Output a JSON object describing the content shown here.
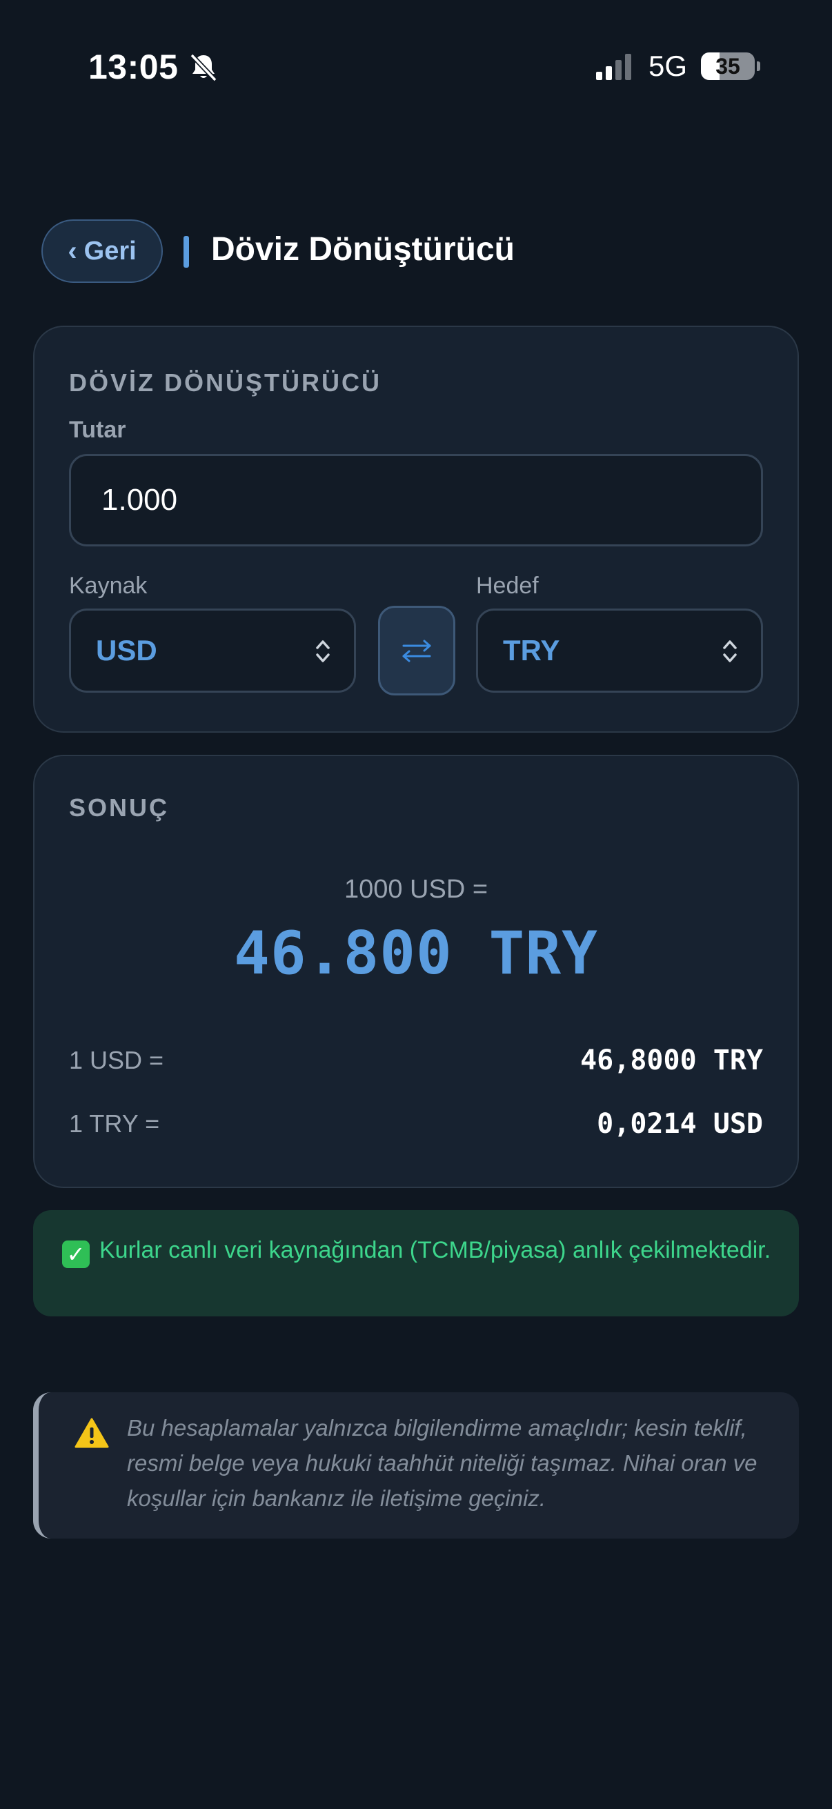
{
  "status_bar": {
    "time": "13:05",
    "network": "5G",
    "battery": "35",
    "battery_level": 0.35
  },
  "header": {
    "back_label": "Geri",
    "title": "Döviz Dönüştürücü"
  },
  "converter": {
    "section_title": "DÖVİZ DÖNÜŞTÜRÜCÜ",
    "amount_label": "Tutar",
    "amount_value": "1.000",
    "source_label": "Kaynak",
    "source_value": "USD",
    "target_label": "Hedef",
    "target_value": "TRY"
  },
  "result": {
    "section_title": "SONUÇ",
    "equation": "1000 USD =",
    "value": "46.800 TRY",
    "rates": [
      {
        "label": "1 USD =",
        "value": "46,8000 TRY"
      },
      {
        "label": "1 TRY =",
        "value": "0,0214 USD"
      }
    ]
  },
  "info_banner": {
    "text": "Kurlar canlı veri kaynağından (TCMB/piyasa) anlık çekilmektedir."
  },
  "disclaimer": {
    "text": "Bu hesaplamalar yalnızca bilgilendirme amaçlıdır; kesin teklif, resmi belge veya hukuki taahhüt niteliği taşımaz. Nihai oran ve koşullar için bankanız ile iletişime geçiniz."
  },
  "colors": {
    "background": "#0f1721",
    "card": "#172230",
    "accent": "#5b9de0",
    "success": "#3dd68c"
  }
}
